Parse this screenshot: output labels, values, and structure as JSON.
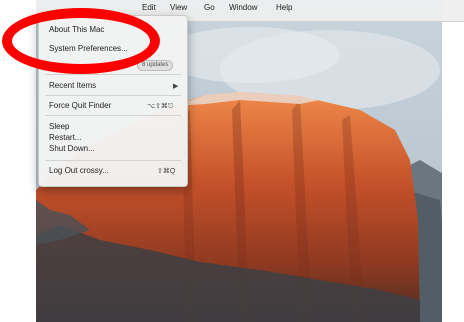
{
  "menubar": {
    "items": [
      {
        "label": "Edit"
      },
      {
        "label": "View"
      },
      {
        "label": "Go"
      },
      {
        "label": "Window"
      },
      {
        "label": "Help"
      }
    ]
  },
  "apple_menu": {
    "about": "About This Mac",
    "system_preferences": "System Preferences...",
    "updates_badge": "8 updates",
    "recent_items": "Recent Items",
    "recent_items_arrow": "▶",
    "force_quit": "Force Quit Finder",
    "force_quit_shortcut": "⌥⇧⌘⎋",
    "sleep": "Sleep",
    "restart": "Restart...",
    "shut_down": "Shut Down...",
    "log_out": "Log Out crossy...",
    "log_out_shortcut": "⇧⌘Q"
  },
  "colors": {
    "annotation": "#ff0000",
    "wallpaper_rock": "#c0552a"
  }
}
